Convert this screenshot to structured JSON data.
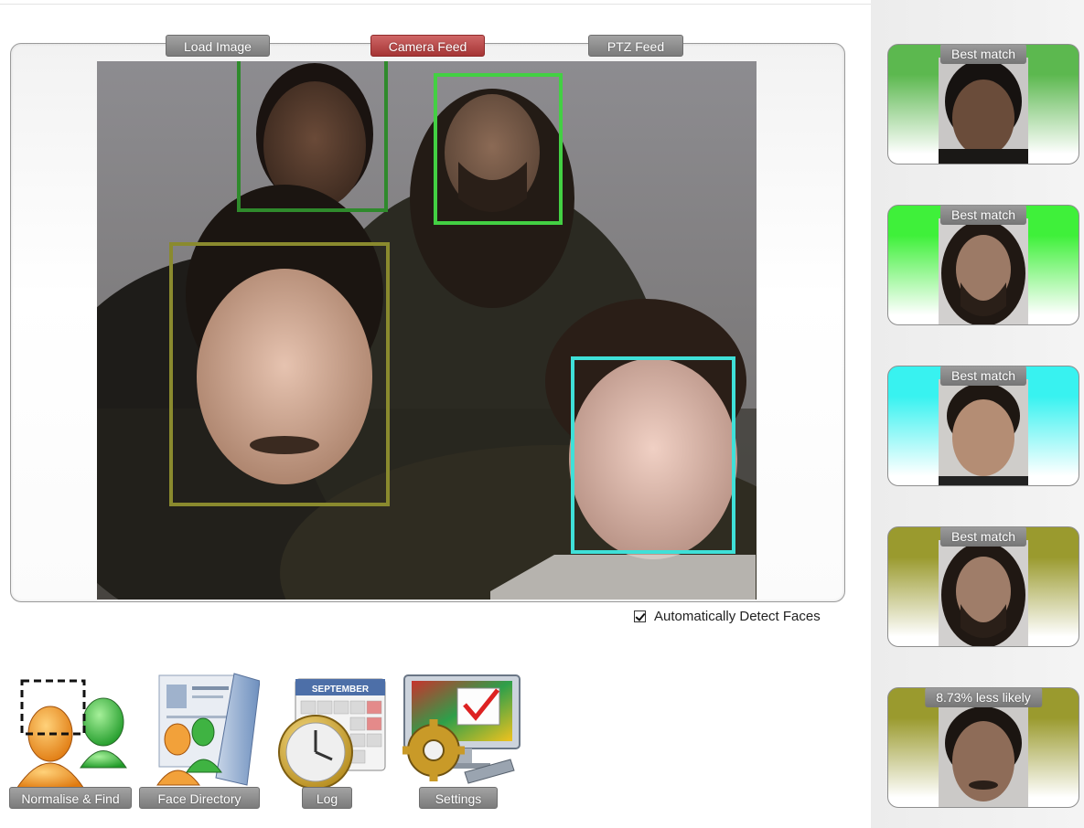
{
  "feed_tabs": {
    "load_image": "Load Image",
    "camera_feed": "Camera Feed",
    "ptz_feed": "PTZ Feed"
  },
  "options": {
    "auto_detect_label": "Automatically Detect Faces",
    "auto_detect_checked": true
  },
  "detected_faces": [
    {
      "color": "#2f8a2c"
    },
    {
      "color": "#43d043"
    },
    {
      "color": "#8a8a2e"
    },
    {
      "color": "#3fe0d8"
    }
  ],
  "matches": [
    {
      "label": "Best match",
      "color": "#5cb84f"
    },
    {
      "label": "Best match",
      "color": "#3ff03a"
    },
    {
      "label": "Best match",
      "color": "#38f2f0"
    },
    {
      "label": "Best match",
      "color": "#9a9a2e"
    },
    {
      "label": "8.73% less likely",
      "color": "#9a9a2e"
    }
  ],
  "toolbar": {
    "normalise_find": "Normalise & Find",
    "face_directory": "Face Directory",
    "log": "Log",
    "settings": "Settings"
  },
  "icons": {
    "normalise_find": "user-find-icon",
    "face_directory": "face-directory-icon",
    "log": "calendar-clock-icon",
    "settings": "settings-gear-icon",
    "calendar_month": "SEPTEMBER"
  }
}
